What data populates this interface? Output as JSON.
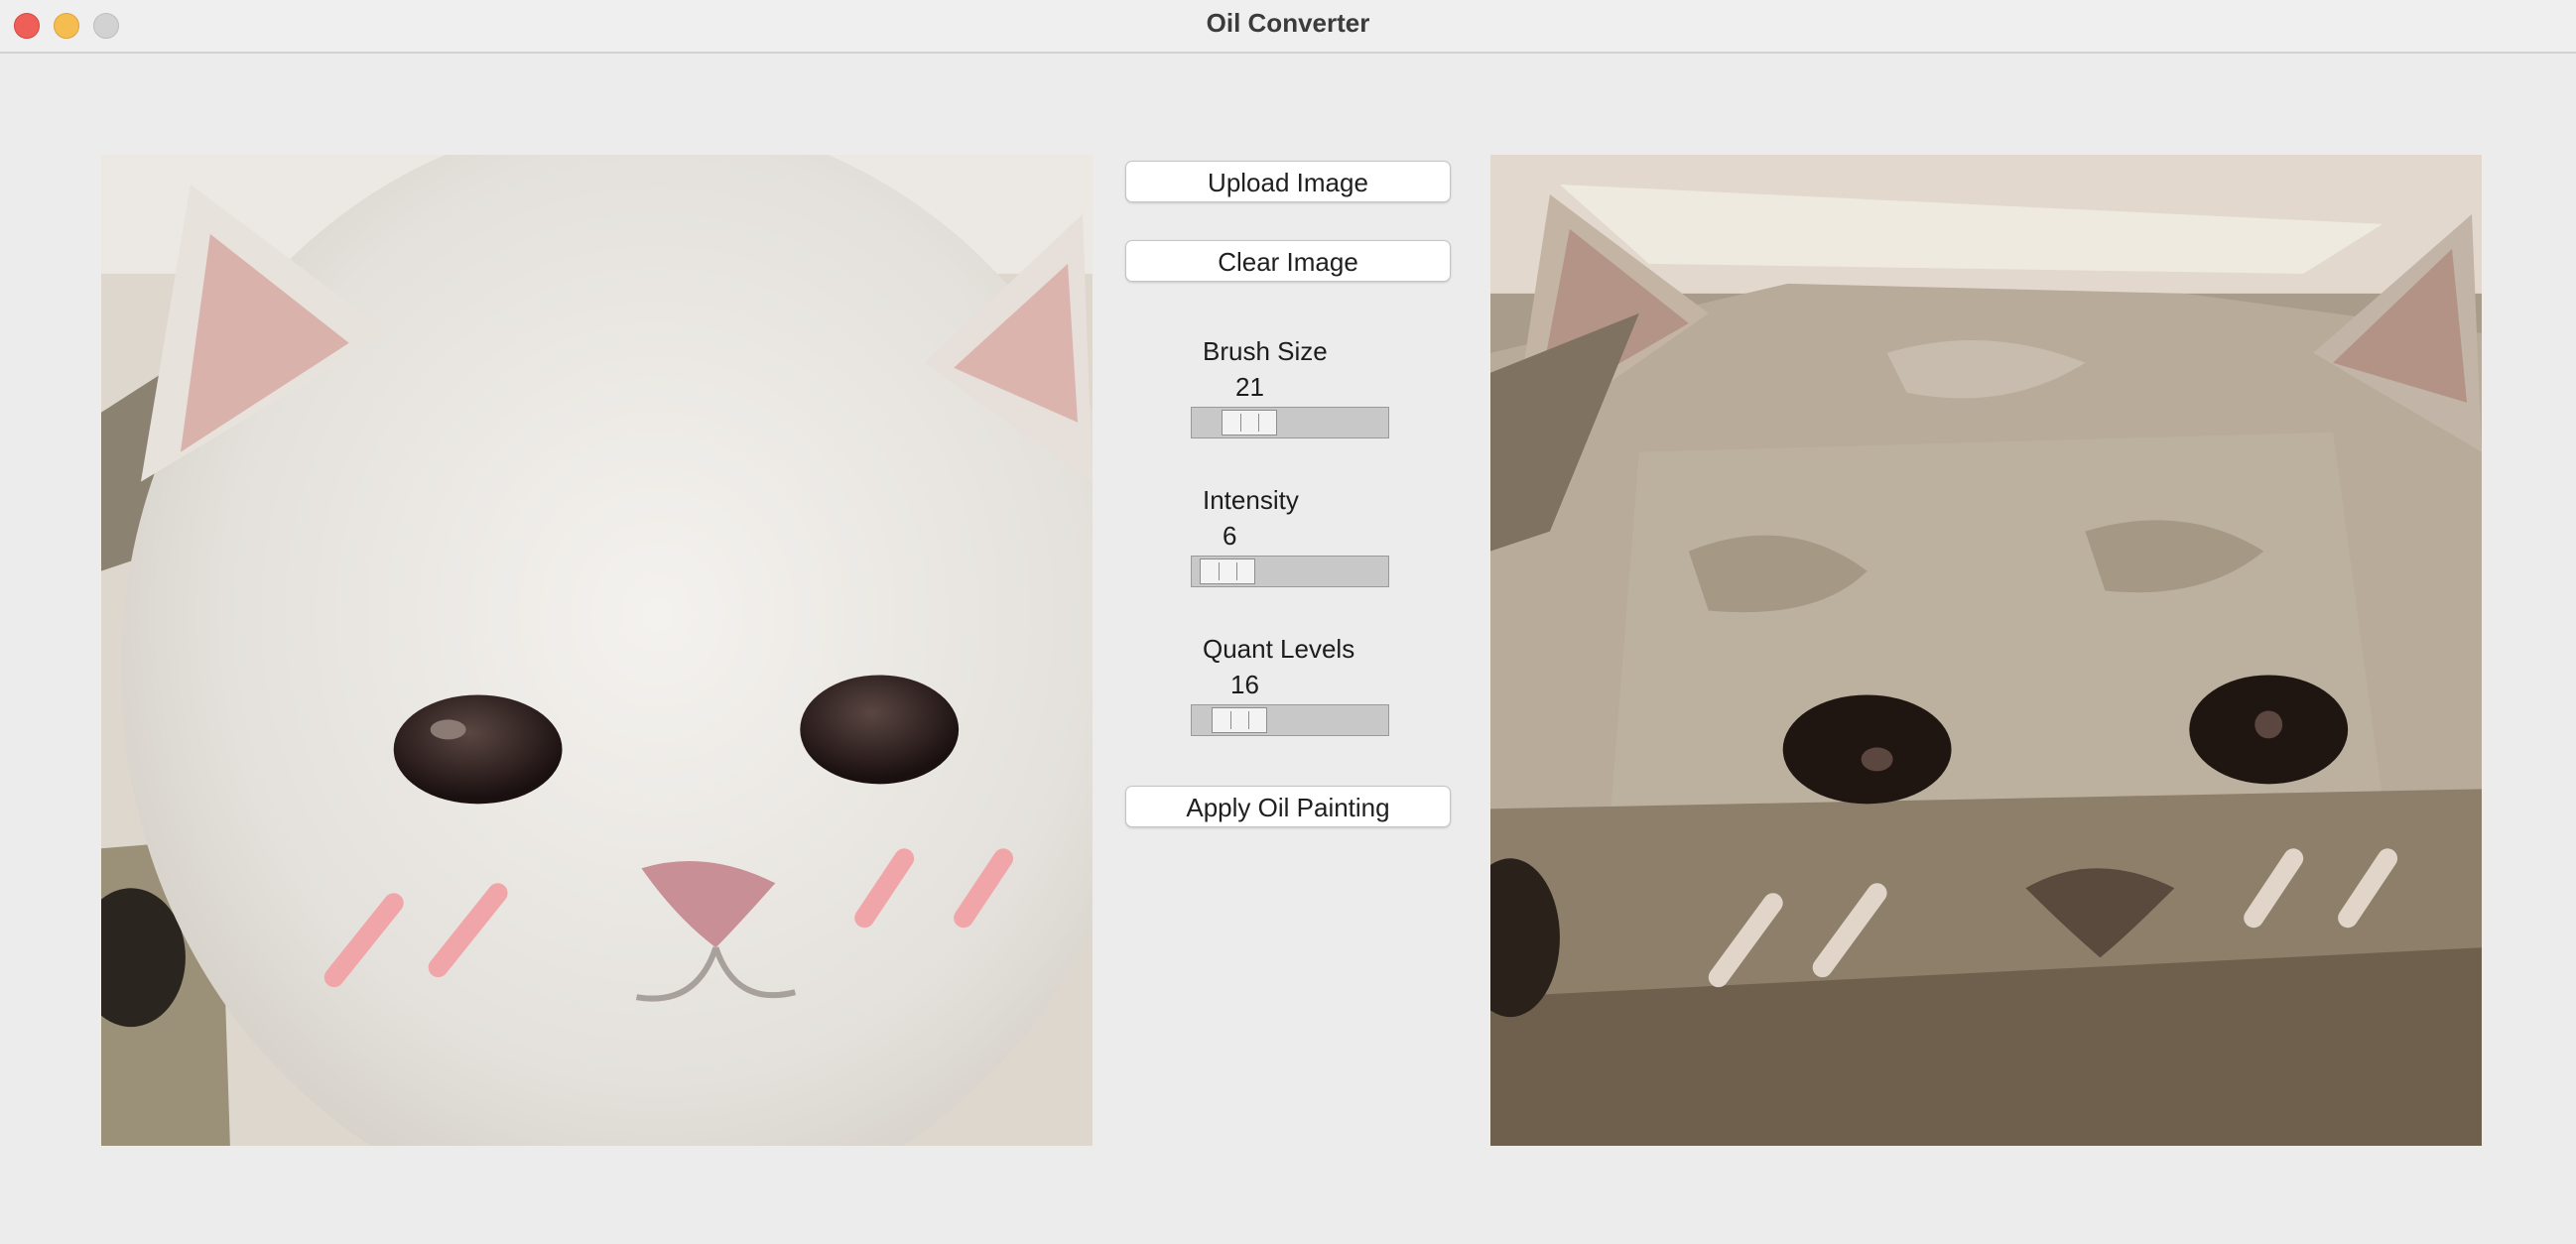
{
  "window": {
    "title": "Oil Converter"
  },
  "buttons": {
    "upload": "Upload Image",
    "clear": "Clear Image",
    "apply": "Apply Oil Painting"
  },
  "controls": {
    "brush_size": {
      "label": "Brush Size",
      "value": "21"
    },
    "intensity": {
      "label": "Intensity",
      "value": "6"
    },
    "quant_levels": {
      "label": "Quant Levels",
      "value": "16"
    }
  },
  "images": {
    "original": "white-kitten-photo",
    "painted": "oil-painting-result"
  }
}
